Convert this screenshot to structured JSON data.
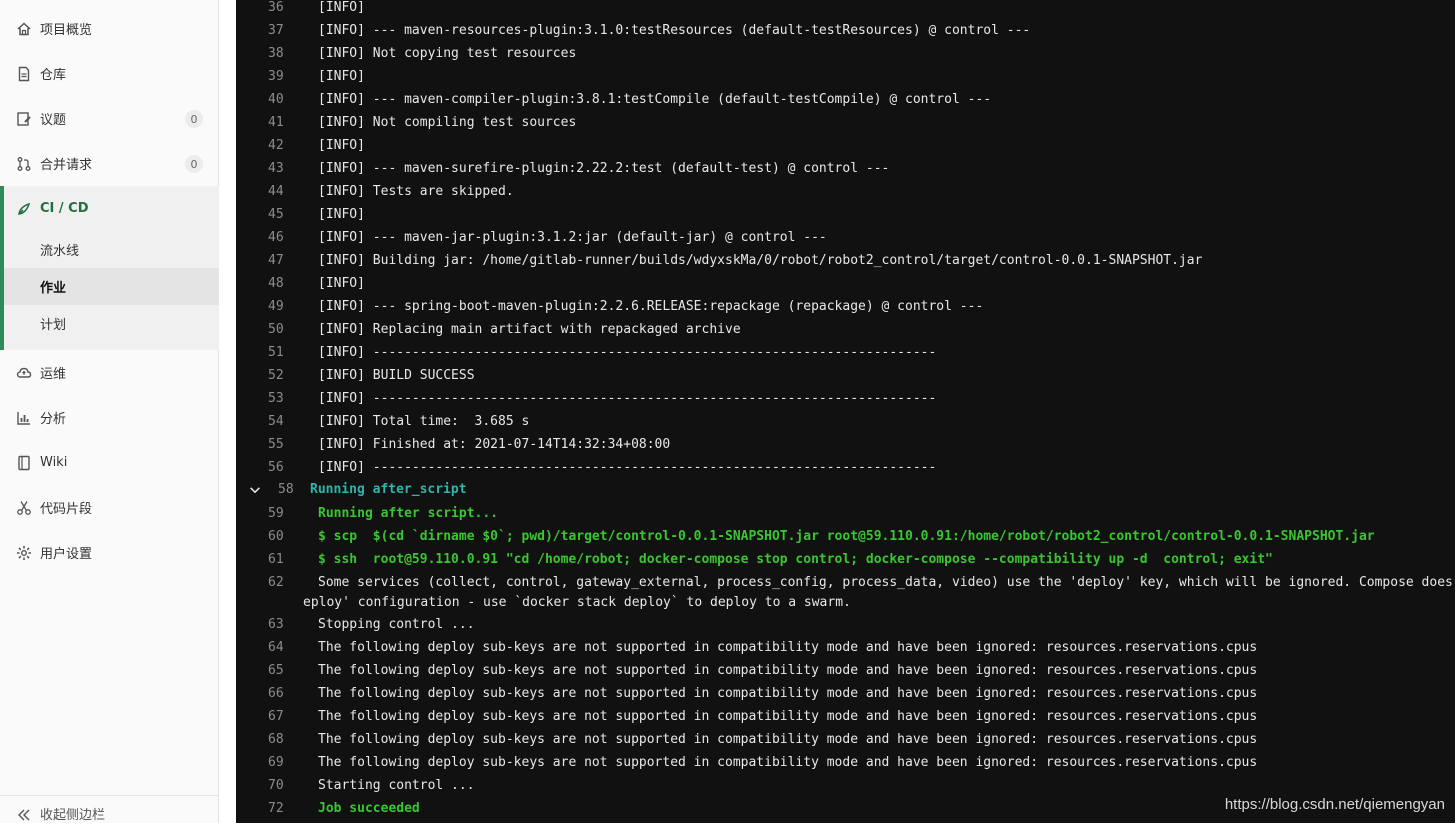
{
  "sidebar": {
    "items": [
      {
        "label": "项目概览",
        "icon": "home-icon"
      },
      {
        "label": "仓库",
        "icon": "document-icon"
      },
      {
        "label": "议题",
        "icon": "issues-icon",
        "badge": "0"
      },
      {
        "label": "合并请求",
        "icon": "merge-request-icon",
        "badge": "0"
      }
    ],
    "cicd": {
      "label": "CI / CD",
      "icon": "rocket-icon",
      "subitems": [
        {
          "label": "流水线"
        },
        {
          "label": "作业"
        },
        {
          "label": "计划"
        }
      ]
    },
    "items_bottom": [
      {
        "label": "运维",
        "icon": "cloud-icon"
      },
      {
        "label": "分析",
        "icon": "chart-icon"
      },
      {
        "label": "Wiki",
        "icon": "book-icon"
      },
      {
        "label": "代码片段",
        "icon": "scissors-icon"
      },
      {
        "label": "用户设置",
        "icon": "gear-icon"
      }
    ],
    "collapse_label": "收起侧边栏"
  },
  "log": {
    "lines": [
      {
        "num": "36",
        "text": "[INFO]"
      },
      {
        "num": "37",
        "text": "[INFO] --- maven-resources-plugin:3.1.0:testResources (default-testResources) @ control ---"
      },
      {
        "num": "38",
        "text": "[INFO] Not copying test resources"
      },
      {
        "num": "39",
        "text": "[INFO]"
      },
      {
        "num": "40",
        "text": "[INFO] --- maven-compiler-plugin:3.8.1:testCompile (default-testCompile) @ control ---"
      },
      {
        "num": "41",
        "text": "[INFO] Not compiling test sources"
      },
      {
        "num": "42",
        "text": "[INFO]"
      },
      {
        "num": "43",
        "text": "[INFO] --- maven-surefire-plugin:2.22.2:test (default-test) @ control ---"
      },
      {
        "num": "44",
        "text": "[INFO] Tests are skipped."
      },
      {
        "num": "45",
        "text": "[INFO]"
      },
      {
        "num": "46",
        "text": "[INFO] --- maven-jar-plugin:3.1.2:jar (default-jar) @ control ---"
      },
      {
        "num": "47",
        "text": "[INFO] Building jar: /home/gitlab-runner/builds/wdyxskMa/0/robot/robot2_control/target/control-0.0.1-SNAPSHOT.jar"
      },
      {
        "num": "48",
        "text": "[INFO]"
      },
      {
        "num": "49",
        "text": "[INFO] --- spring-boot-maven-plugin:2.2.6.RELEASE:repackage (repackage) @ control ---"
      },
      {
        "num": "50",
        "text": "[INFO] Replacing main artifact with repackaged archive"
      },
      {
        "num": "51",
        "text": "[INFO] ------------------------------------------------------------------------"
      },
      {
        "num": "52",
        "text": "[INFO] BUILD SUCCESS"
      },
      {
        "num": "53",
        "text": "[INFO] ------------------------------------------------------------------------"
      },
      {
        "num": "54",
        "text": "[INFO] Total time:  3.685 s"
      },
      {
        "num": "55",
        "text": "[INFO] Finished at: 2021-07-14T14:32:34+08:00"
      },
      {
        "num": "56",
        "text": "[INFO] ------------------------------------------------------------------------"
      },
      {
        "num": "58",
        "text": "Running after_script"
      },
      {
        "num": "59",
        "text": "Running after script..."
      },
      {
        "num": "60",
        "text": "$ scp  $(cd `dirname $0`; pwd)/target/control-0.0.1-SNAPSHOT.jar root@59.110.0.91:/home/robot/robot2_control/control-0.0.1-SNAPSHOT.jar"
      },
      {
        "num": "61",
        "text": "$ ssh  root@59.110.0.91 \"cd /home/robot; docker-compose stop control; docker-compose --compatibility up -d  control; exit\""
      },
      {
        "num": "62",
        "text": "Some services (collect, control, gateway_external, process_config, process_data, video) use the 'deploy' key, which will be ignored. Compose does",
        "wrap": "eploy' configuration - use `docker stack deploy` to deploy to a swarm."
      },
      {
        "num": "63",
        "text": "Stopping control ..."
      },
      {
        "num": "64",
        "text": "The following deploy sub-keys are not supported in compatibility mode and have been ignored: resources.reservations.cpus"
      },
      {
        "num": "65",
        "text": "The following deploy sub-keys are not supported in compatibility mode and have been ignored: resources.reservations.cpus"
      },
      {
        "num": "66",
        "text": "The following deploy sub-keys are not supported in compatibility mode and have been ignored: resources.reservations.cpus"
      },
      {
        "num": "67",
        "text": "The following deploy sub-keys are not supported in compatibility mode and have been ignored: resources.reservations.cpus"
      },
      {
        "num": "68",
        "text": "The following deploy sub-keys are not supported in compatibility mode and have been ignored: resources.reservations.cpus"
      },
      {
        "num": "69",
        "text": "The following deploy sub-keys are not supported in compatibility mode and have been ignored: resources.reservations.cpus"
      },
      {
        "num": "70",
        "text": "Starting control ..."
      },
      {
        "num": "72",
        "text": "Job succeeded"
      }
    ]
  },
  "watermark": "https://blog.csdn.net/qiemengyan",
  "colors": {
    "accent": "#2e8b57",
    "log_bg": "#111111",
    "section": "#2fb5ab",
    "success": "#39c630"
  }
}
